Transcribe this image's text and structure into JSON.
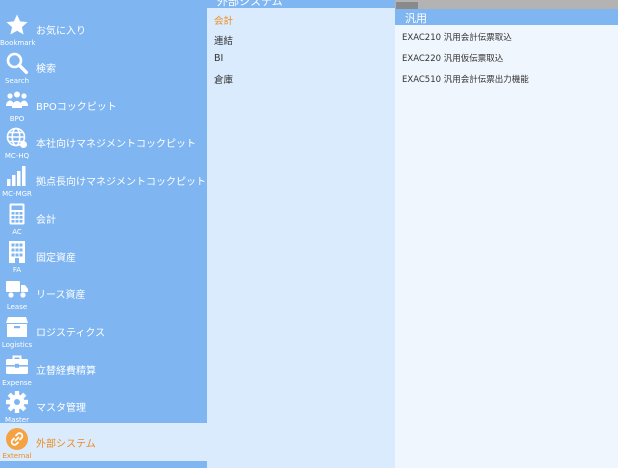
{
  "sidebar": {
    "items": [
      {
        "caption": "Bookmark",
        "label": "お気に入り",
        "icon": "star-icon"
      },
      {
        "caption": "Search",
        "label": "検索",
        "icon": "search-icon"
      },
      {
        "caption": "BPO",
        "label": "BPOコックピット",
        "icon": "people-icon"
      },
      {
        "caption": "MC-HQ",
        "label": "本社向けマネジメントコックピット",
        "icon": "globe-icon"
      },
      {
        "caption": "MC-MGR",
        "label": "拠点長向けマネジメントコックピット",
        "icon": "bar-chart-icon"
      },
      {
        "caption": "AC",
        "label": "会計",
        "icon": "calculator-icon"
      },
      {
        "caption": "FA",
        "label": "固定資産",
        "icon": "building-icon"
      },
      {
        "caption": "Lease",
        "label": "リース資産",
        "icon": "truck-icon"
      },
      {
        "caption": "Logistics",
        "label": "ロジスティクス",
        "icon": "box-icon"
      },
      {
        "caption": "Expense",
        "label": "立替経費精算",
        "icon": "briefcase-icon"
      },
      {
        "caption": "Master",
        "label": "マスタ管理",
        "icon": "gear-icon"
      },
      {
        "caption": "External",
        "label": "外部システム",
        "icon": "link-icon",
        "active": true
      }
    ]
  },
  "middle": {
    "title": "外部システム",
    "items": [
      {
        "label": "会計",
        "active": true
      },
      {
        "label": "連結"
      },
      {
        "label": "BI"
      },
      {
        "label": "倉庫"
      }
    ]
  },
  "right": {
    "title": "汎用",
    "items": [
      {
        "label": "EXAC210 汎用会計伝票取込"
      },
      {
        "label": "EXAC220 汎用仮伝票取込"
      },
      {
        "label": "EXAC510 汎用会計伝票出力機能"
      }
    ]
  },
  "colors": {
    "sidebar_bg": "#7fb6f2",
    "panel_bg": "#d9ebfd",
    "right_bg": "#f0f6fd",
    "accent": "#f08a1d"
  }
}
